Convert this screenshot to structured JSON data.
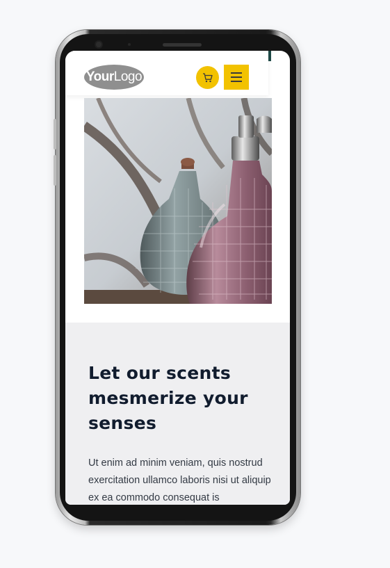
{
  "header": {
    "logo": {
      "bold": "Your",
      "light": "Logo"
    },
    "cart_icon": "cart-icon",
    "menu_icon": "hamburger-menu-icon"
  },
  "hero": {
    "image": "perfume-bottles-photo"
  },
  "content": {
    "headline": "Let our scents mesmerize your senses",
    "body": "Ut enim ad minim veniam, quis nostrud exercitation ullamco laboris nisi ut aliquip ex ea commodo consequat is"
  },
  "colors": {
    "accent": "#f2c200",
    "heading": "#111c2e",
    "section_bg": "#efeff1",
    "page_bg": "#f7f8fa"
  }
}
